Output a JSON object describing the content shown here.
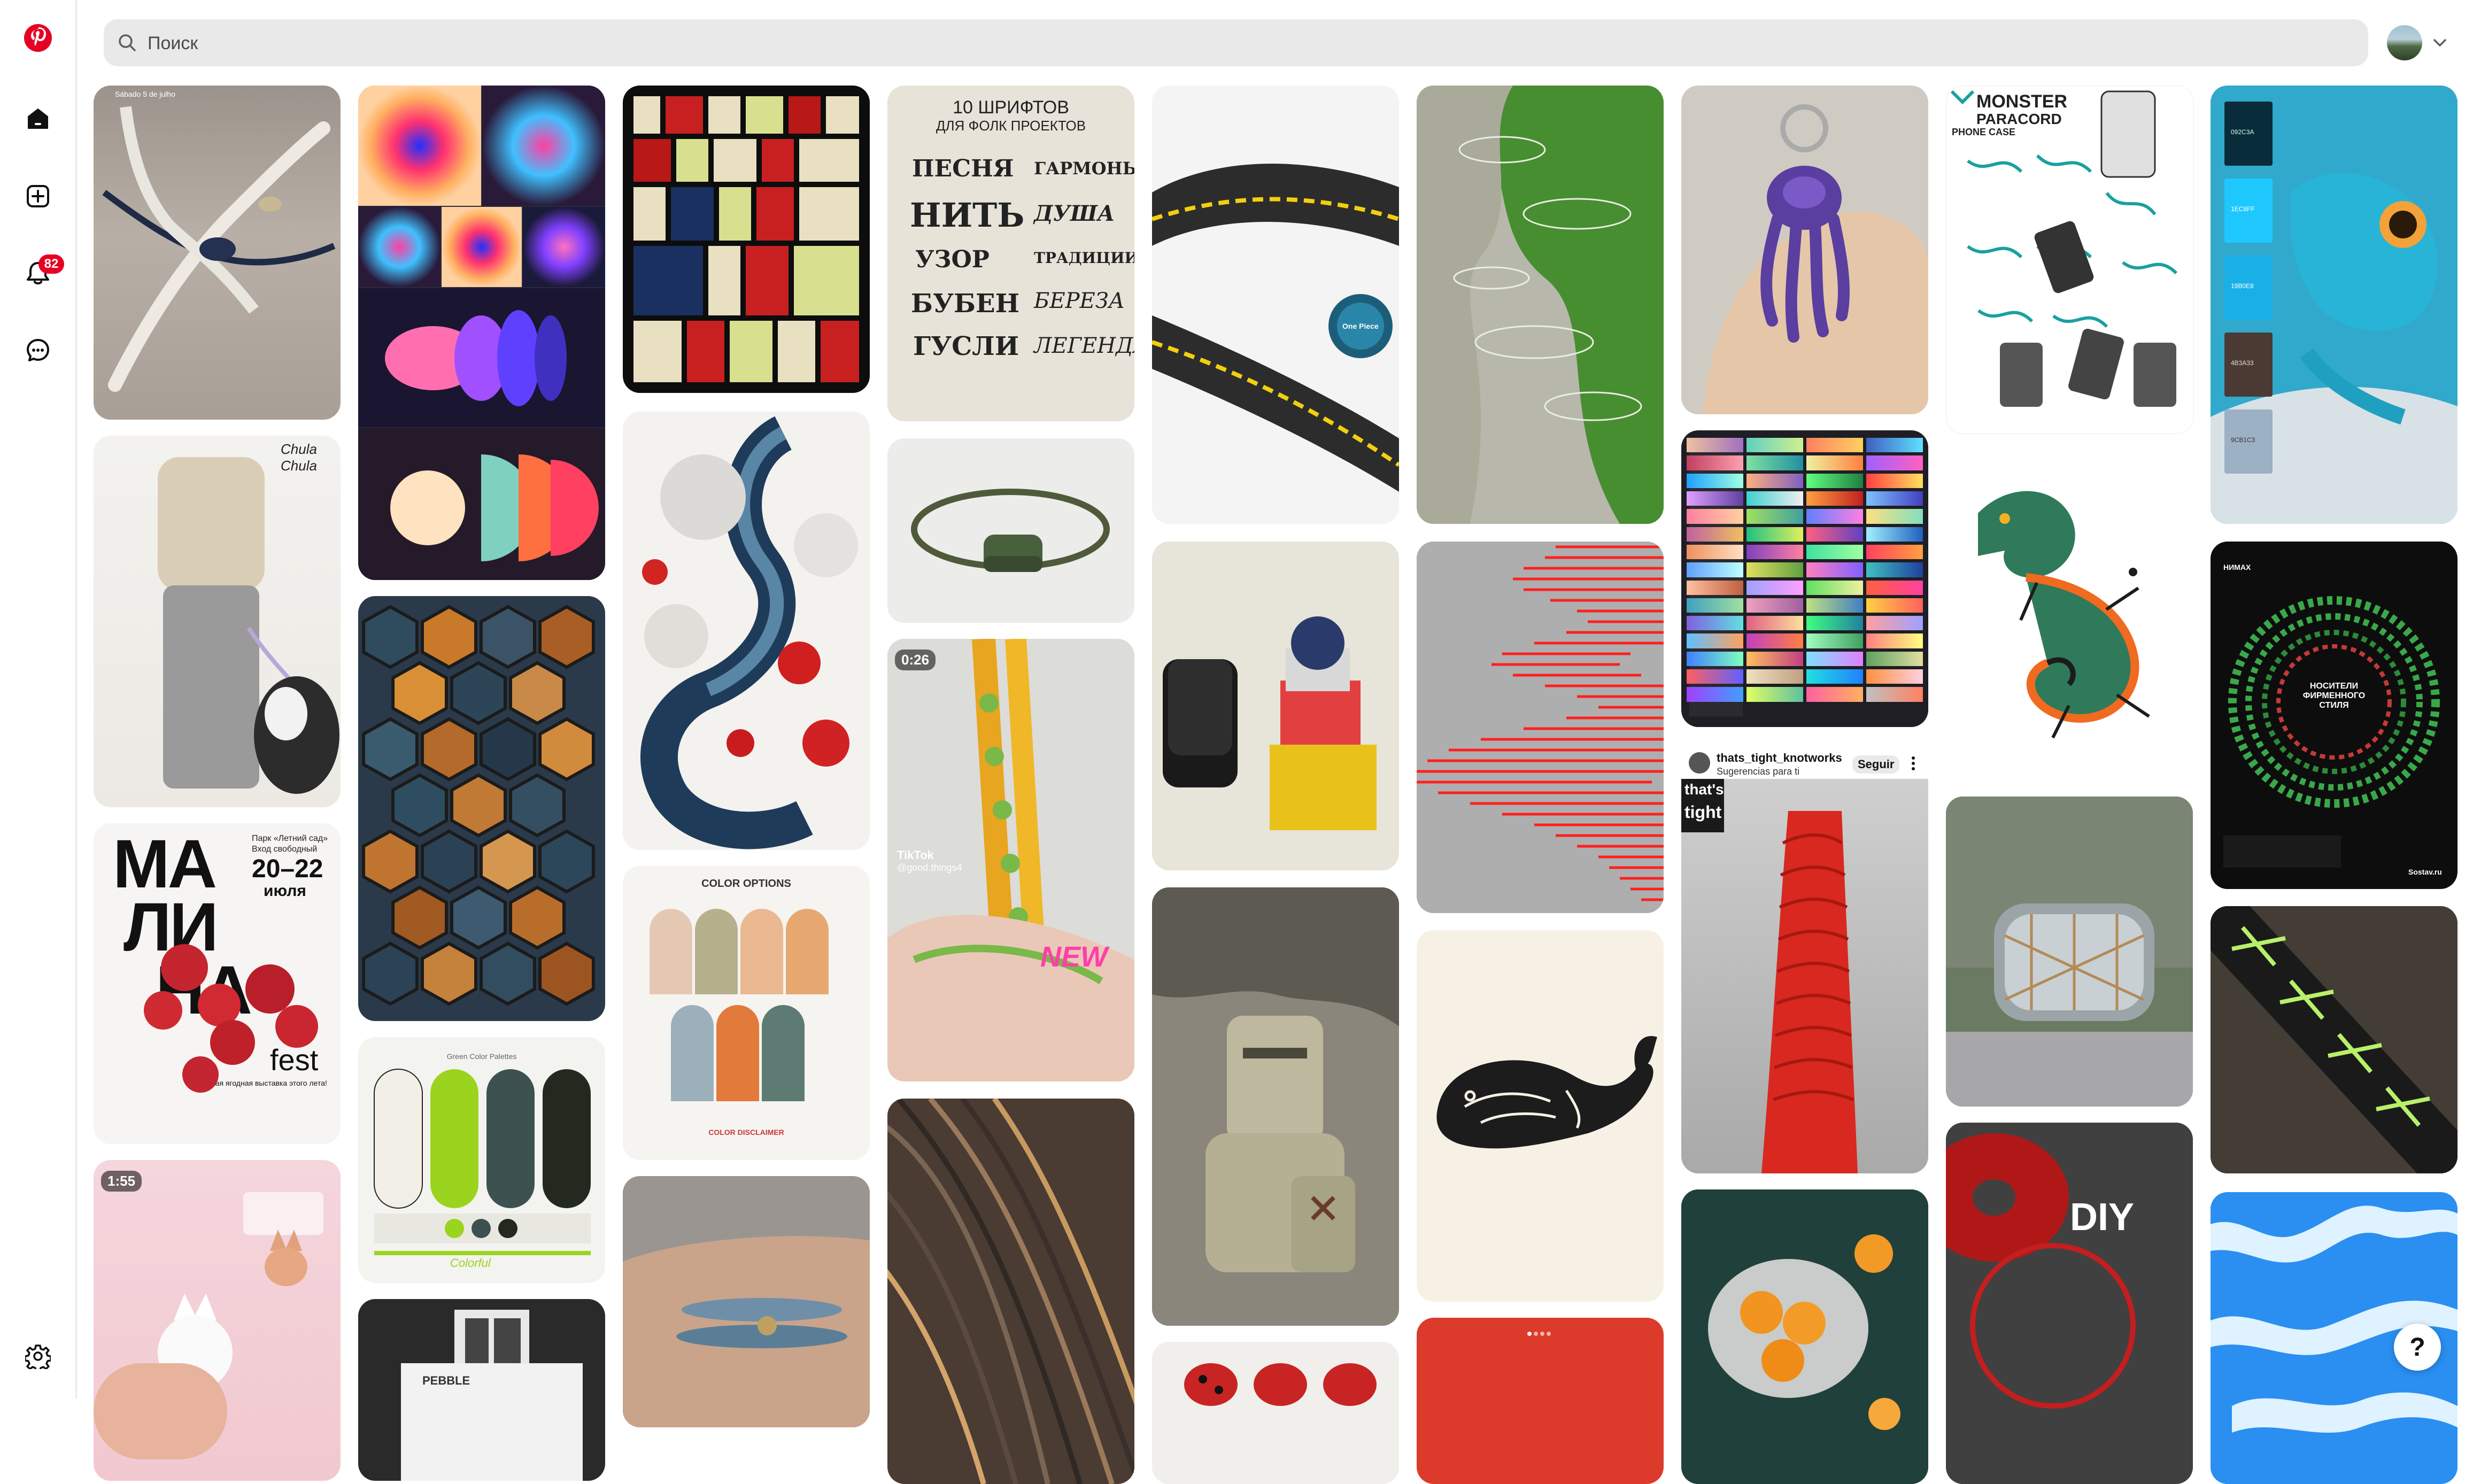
{
  "sidebar": {
    "items": [
      {
        "icon": "pinterest-logo-icon"
      },
      {
        "icon": "home-icon"
      },
      {
        "icon": "create-plus-icon"
      },
      {
        "icon": "notifications-bell-icon",
        "badge": "82"
      },
      {
        "icon": "messages-icon"
      },
      {
        "icon": "settings-gear-icon"
      }
    ],
    "brand_color": "#e60023"
  },
  "search": {
    "placeholder": "Поиск",
    "value": ""
  },
  "pins": {
    "p1": {
      "text": "Sábado 5 de julho"
    },
    "p2": {
      "text": "Chula Chula"
    },
    "p3": {
      "line1": "МА",
      "line2": "ЛИ",
      "line3": "НА",
      "line4": "fest",
      "info_top": "Парк «Летний сад»",
      "info_entry": "Вход свободный",
      "dates": "20–22",
      "month": "июля",
      "desc": "Самая ягодная выставка этого лета!"
    },
    "p4": {
      "duration": "1:55"
    },
    "p5": {
      "text": ""
    },
    "p6": {
      "text": ""
    },
    "p7": {
      "title": "Green Color Palettes",
      "word": "Colorful"
    },
    "p8": {
      "text": "PEBBLE"
    },
    "p11": {
      "title": "COLOR OPTIONS",
      "footer": "COLOR DISCLAIMER"
    },
    "p13": {
      "title1": "10 ШРИФТОВ",
      "title2": "ДЛЯ ФОЛК ПРОЕКТОВ",
      "words": [
        "ПЕСНЯ",
        "ГАРМОНЬ",
        "НИТЬ",
        "ДУША",
        "УЗОР",
        "ТРАДИЦИИ",
        "БУБЕН",
        "БЕРЕЗА",
        "ГУСЛИ",
        "ЛЕГЕНДА"
      ]
    },
    "p15": {
      "duration": "0:26",
      "tiktok": "TikTok",
      "handle": "@good.things4",
      "new": "NEW"
    },
    "p16": {
      "text": "One Piece"
    },
    "p25": {
      "title": "MONSTER",
      "subtitle": "PARACORD",
      "label": "PHONE CASE"
    },
    "p23": {
      "user": "thats_tight_knotworks",
      "sub": "Sugerencias para ti",
      "follow": "Seguir",
      "badge_top": "that's",
      "badge_bottom": "tight"
    },
    "p27": {
      "text": "DIY"
    },
    "p28": {
      "codes": [
        "092C3A",
        "1EC8FF",
        "19B0E8",
        "4B3A33",
        "9CB1C3"
      ]
    },
    "p29": {
      "brand": "НИМАХ",
      "title": "НОСИТЕЛИ ФИРМЕННОГО СТИЛЯ",
      "footer": "Sostav.ru"
    }
  },
  "help": {
    "label": "?"
  }
}
